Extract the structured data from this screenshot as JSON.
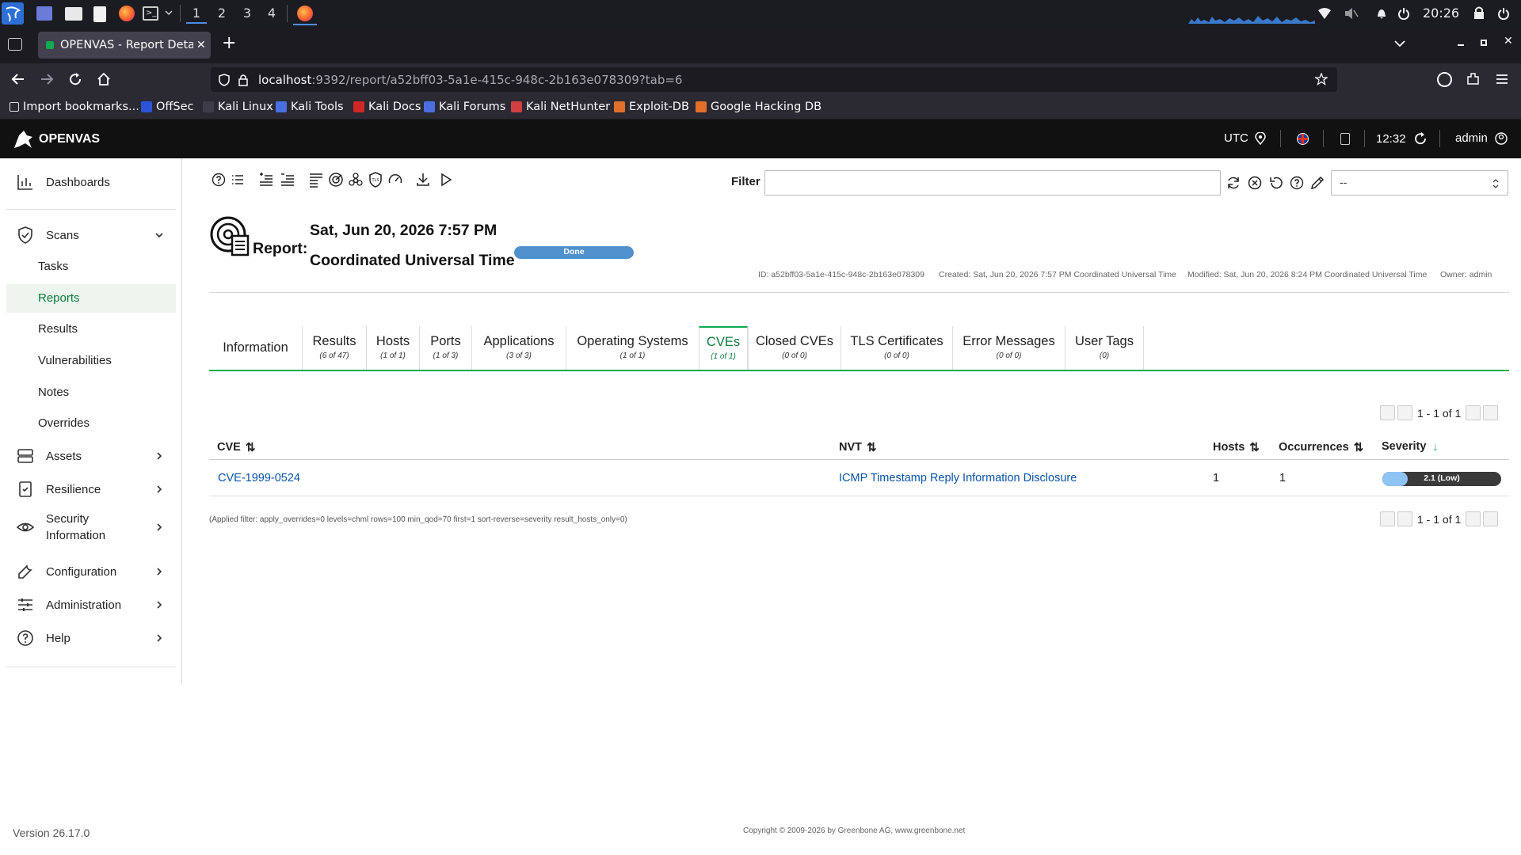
{
  "system": {
    "workspaces": [
      "1",
      "2",
      "3",
      "4"
    ],
    "clock": "20:26"
  },
  "browser": {
    "tab_title": "OPENVAS - Report Details",
    "url_host": "localhost",
    "url_rest": ":9392/report/a52bff03-5a1e-415c-948c-2b163e078309?tab=6",
    "bookmarks": [
      "Import bookmarks...",
      "OffSec",
      "Kali Linux",
      "Kali Tools",
      "Kali Docs",
      "Kali Forums",
      "Kali NetHunter",
      "Exploit-DB",
      "Google Hacking DB"
    ]
  },
  "appbar": {
    "brand": "OPENVAS",
    "timezone": "UTC",
    "time": "12:32",
    "user": "admin"
  },
  "sidebar": {
    "dashboards": "Dashboards",
    "scans": "Scans",
    "scan_items": [
      "Tasks",
      "Reports",
      "Results",
      "Vulnerabilities",
      "Notes",
      "Overrides"
    ],
    "assets": "Assets",
    "resilience": "Resilience",
    "security_information_1": "Security",
    "security_information_2": "Information",
    "configuration": "Configuration",
    "administration": "Administration",
    "help": "Help",
    "version": "Version 26.17.0"
  },
  "filter": {
    "label": "Filter",
    "value": "",
    "select_value": "--"
  },
  "report": {
    "label": "Report:",
    "date_line": "Sat, Jun 20, 2026 7:57 PM",
    "tz_line": "Coordinated Universal Time",
    "status": "Done",
    "status_progress": 1.0,
    "id": "ID: a52bff03-5a1e-415c-948c-2b163e078309",
    "created": "Created: Sat, Jun 20, 2026 7:57 PM Coordinated Universal Time",
    "modified": "Modified: Sat, Jun 20, 2026 8:24 PM Coordinated Universal Time",
    "owner": "Owner: admin"
  },
  "tabs": [
    {
      "label": "Information",
      "count": ""
    },
    {
      "label": "Results",
      "count": "(6 of 47)"
    },
    {
      "label": "Hosts",
      "count": "(1 of 1)"
    },
    {
      "label": "Ports",
      "count": "(1 of 3)"
    },
    {
      "label": "Applications",
      "count": "(3 of 3)"
    },
    {
      "label": "Operating Systems",
      "count": "(1 of 1)"
    },
    {
      "label": "CVEs",
      "count": "(1 of 1)"
    },
    {
      "label": "Closed CVEs",
      "count": "(0 of 0)"
    },
    {
      "label": "TLS Certificates",
      "count": "(0 of 0)"
    },
    {
      "label": "Error Messages",
      "count": "(0 of 0)"
    },
    {
      "label": "User Tags",
      "count": "(0)"
    }
  ],
  "pagination": "1 - 1 of 1",
  "table": {
    "headers": [
      "CVE",
      "NVT",
      "Hosts",
      "Occurrences",
      "Severity"
    ],
    "rows": [
      {
        "cve": "CVE-1999-0524",
        "nvt": "ICMP Timestamp Reply Information Disclosure",
        "hosts": "1",
        "occurrences": "1",
        "severity": "2.1 (Low)",
        "severity_score": 2.1
      }
    ]
  },
  "applied_filter": "(Applied filter: apply_overrides=0 levels=chml rows=100 min_qod=70 first=1 sort-reverse=severity result_hosts_only=0)",
  "copyright": "Copyright © 2009-2026 by Greenbone AG, www.greenbone.net",
  "colors": {
    "accent_green": "#11ab51",
    "link_blue": "#0a53a8",
    "status_blue": "#4f91cd",
    "severity_low": "#8ec3f4"
  }
}
